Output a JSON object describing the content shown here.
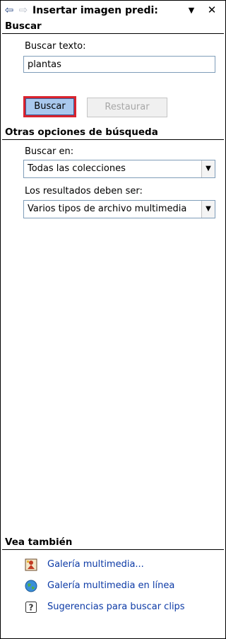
{
  "header": {
    "title": "Insertar imagen predi:",
    "back_icon": "back-arrow-icon",
    "forward_icon": "forward-arrow-icon",
    "menu_icon": "dropdown-arrow-icon",
    "close_icon": "close-icon"
  },
  "search_section": {
    "heading": "Buscar",
    "search_text_label": "Buscar texto:",
    "search_text_value": "plantas",
    "search_button": "Buscar",
    "reset_button": "Restaurar"
  },
  "options_section": {
    "heading": "Otras opciones de búsqueda",
    "search_in_label": "Buscar en:",
    "search_in_value": "Todas las colecciones",
    "results_label": "Los resultados deben ser:",
    "results_value": "Varios tipos de archivo multimedia"
  },
  "see_also": {
    "heading": "Vea también",
    "links": [
      {
        "label": "Galería multimedia...",
        "icon": "media-gallery-icon"
      },
      {
        "label": "Galería multimedia en línea",
        "icon": "globe-icon"
      },
      {
        "label": "Sugerencias para buscar clips",
        "icon": "help-icon"
      }
    ]
  },
  "colors": {
    "search_button_bg": "#a9c8ee",
    "search_button_highlight": "#d9232e",
    "link": "#0c3aa6"
  }
}
